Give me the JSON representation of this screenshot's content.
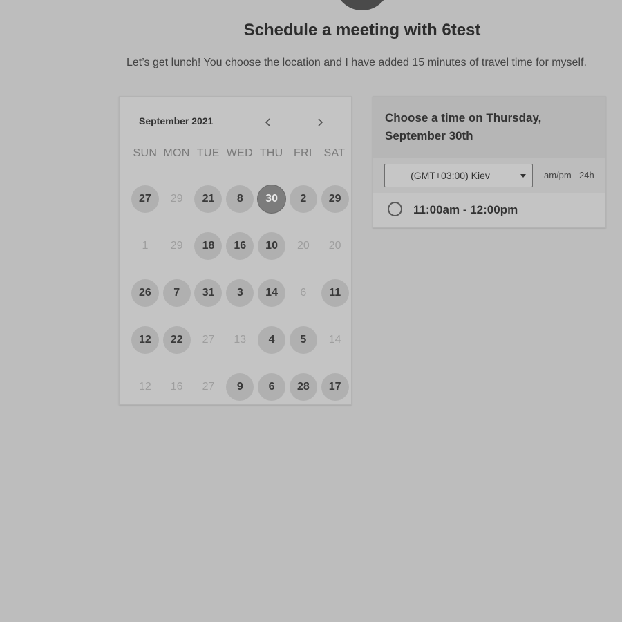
{
  "page": {
    "title": "Schedule a meeting with 6test",
    "description": "Let’s get lunch! You choose the location and I have added 15 minutes of travel time for myself."
  },
  "calendar": {
    "month_label": "September 2021",
    "prev_icon": "chevron-left-icon",
    "next_icon": "chevron-right-icon",
    "weekdays": [
      "SUN",
      "MON",
      "TUE",
      "WED",
      "THU",
      "FRI",
      "SAT"
    ],
    "days": [
      {
        "label": "27",
        "state": "available"
      },
      {
        "label": "29",
        "state": "disabled"
      },
      {
        "label": "21",
        "state": "available"
      },
      {
        "label": "8",
        "state": "available"
      },
      {
        "label": "30",
        "state": "selected"
      },
      {
        "label": "2",
        "state": "available"
      },
      {
        "label": "29",
        "state": "available"
      },
      {
        "label": "1",
        "state": "disabled"
      },
      {
        "label": "29",
        "state": "disabled"
      },
      {
        "label": "18",
        "state": "available"
      },
      {
        "label": "16",
        "state": "available"
      },
      {
        "label": "10",
        "state": "available"
      },
      {
        "label": "20",
        "state": "disabled"
      },
      {
        "label": "20",
        "state": "disabled"
      },
      {
        "label": "26",
        "state": "available"
      },
      {
        "label": "7",
        "state": "available"
      },
      {
        "label": "31",
        "state": "available"
      },
      {
        "label": "3",
        "state": "available"
      },
      {
        "label": "14",
        "state": "available"
      },
      {
        "label": "6",
        "state": "disabled"
      },
      {
        "label": "11",
        "state": "available"
      },
      {
        "label": "12",
        "state": "available"
      },
      {
        "label": "22",
        "state": "available"
      },
      {
        "label": "27",
        "state": "disabled"
      },
      {
        "label": "13",
        "state": "disabled"
      },
      {
        "label": "4",
        "state": "available"
      },
      {
        "label": "5",
        "state": "available"
      },
      {
        "label": "14",
        "state": "disabled"
      },
      {
        "label": "12",
        "state": "disabled"
      },
      {
        "label": "16",
        "state": "disabled"
      },
      {
        "label": "27",
        "state": "disabled"
      },
      {
        "label": "9",
        "state": "available"
      },
      {
        "label": "6",
        "state": "available"
      },
      {
        "label": "28",
        "state": "available"
      },
      {
        "label": "17",
        "state": "available"
      }
    ]
  },
  "time_panel": {
    "heading": "Choose a time on Thursday, September 30th",
    "timezone": "(GMT+03:00) Kiev",
    "format_ampm": "am/pm",
    "format_24h": "24h",
    "slots": [
      "11:00am - 12:00pm"
    ]
  },
  "colors": {
    "background": "#bdbdbd",
    "selected_day": "#7c7c7c",
    "available_day": "#b0b0b0"
  }
}
